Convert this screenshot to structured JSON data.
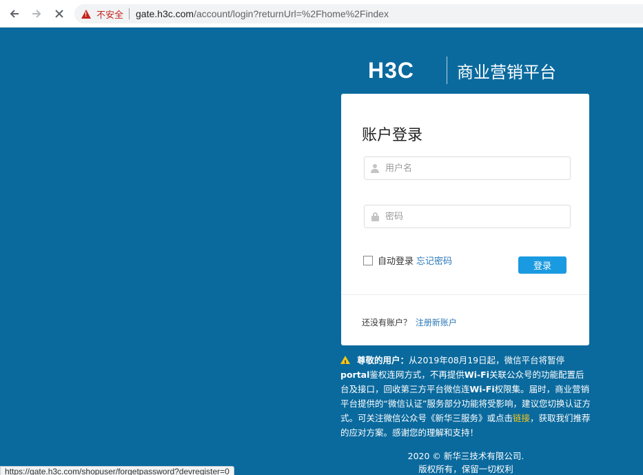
{
  "browser": {
    "insecure_label": "不安全",
    "url_host": "gate.h3c.com",
    "url_path": "/account/login?returnUrl=%2Fhome%2Findex",
    "status_url": "https://gate.h3c.com/shopuser/forgetpassword?devregister=0"
  },
  "header": {
    "logo_text": "H3C",
    "title": "商业营销平台"
  },
  "login": {
    "heading": "账户登录",
    "username_placeholder": "用户名",
    "password_placeholder": "密码",
    "remember_label": "自动登录",
    "forgot_link": "忘记密码",
    "submit_label": "登录",
    "signup_prompt": "还没有账户？",
    "signup_link": "注册新账户"
  },
  "notice": {
    "greeting": "尊敬的用户：",
    "part1": "从2019年08月19日起，微信平台将暂停",
    "portal": "portal",
    "part2": "鉴权连网方式，不再提供",
    "wifi1": "Wi-Fi",
    "part3": "关联公众号的功能配置后台及接口，回收第三方平台微信连",
    "wifi2": "Wi-Fi",
    "part4": "权限集。届时，商业营销平台提供的“微信认证”服务部分功能将受影响，建议您切换认证方式。可关注微信公众号《新华三服务》或点击",
    "link": "链接",
    "part5": "，获取我们推荐的应对方案。感谢您的理解和支持！"
  },
  "footer": {
    "line1": "2020 © 新华三技术有限公司.",
    "line2": "版权所有，保留一切权利"
  },
  "colors": {
    "background": "#0a6a9e",
    "button": "#1a9ae0",
    "link": "#2b78b8",
    "notice_link": "#f5c518"
  }
}
